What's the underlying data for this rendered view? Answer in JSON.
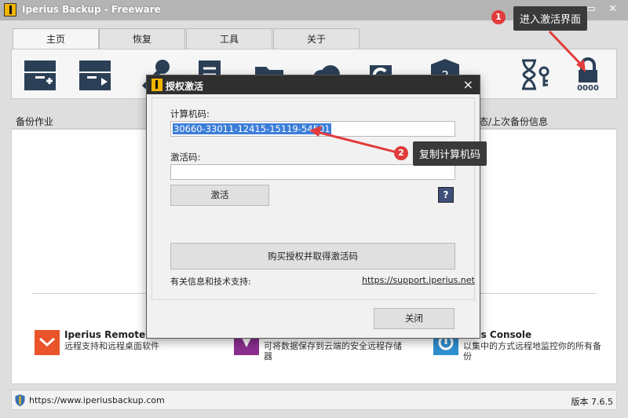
{
  "window": {
    "title": "Iperius Backup - Freeware",
    "controls": "▭ ✕"
  },
  "tabs": [
    {
      "label": "主页"
    },
    {
      "label": "恢复"
    },
    {
      "label": "工具"
    },
    {
      "label": "关于"
    }
  ],
  "section": {
    "left_header": "备份作业",
    "right_header": "态/上次备份信息"
  },
  "promos": [
    {
      "title": "Iperius Remote",
      "desc": "远程支持和远程桌面软件",
      "icon": "remote-icon",
      "color": "#e9542b"
    },
    {
      "title": "",
      "desc": "可将数据保存到云端的安全远程存储器",
      "icon": "storage-icon",
      "color": "#8a2f8f"
    },
    {
      "title": "rius Console",
      "desc": "以集中的方式远程地监控你的所有备份",
      "icon": "console-icon",
      "color": "#2f8fcf"
    }
  ],
  "status": {
    "url": "https://www.iperiusbackup.com",
    "version": "版本 7.6.5"
  },
  "dialog": {
    "title": "授权激活",
    "close": "×",
    "machine_code_label": "计算机码:",
    "machine_code_value": "30660-33011-12415-15119-54501",
    "activation_code_label": "激活码:",
    "activation_code_value": "",
    "activate_button": "激活",
    "help_button": "?",
    "buy_button": "购买授权并取得激活码",
    "support_label": "有关信息和技术支持:",
    "support_link": "https://support.iperius.net",
    "close_button": "关闭"
  },
  "annotations": [
    {
      "number": "1",
      "text": "进入激活界面"
    },
    {
      "number": "2",
      "text": "复制计算机码"
    }
  ],
  "colors": {
    "accent_red": "#e23b3b",
    "callout_bg": "#3a3a3a",
    "selection": "#3b7dd8"
  }
}
